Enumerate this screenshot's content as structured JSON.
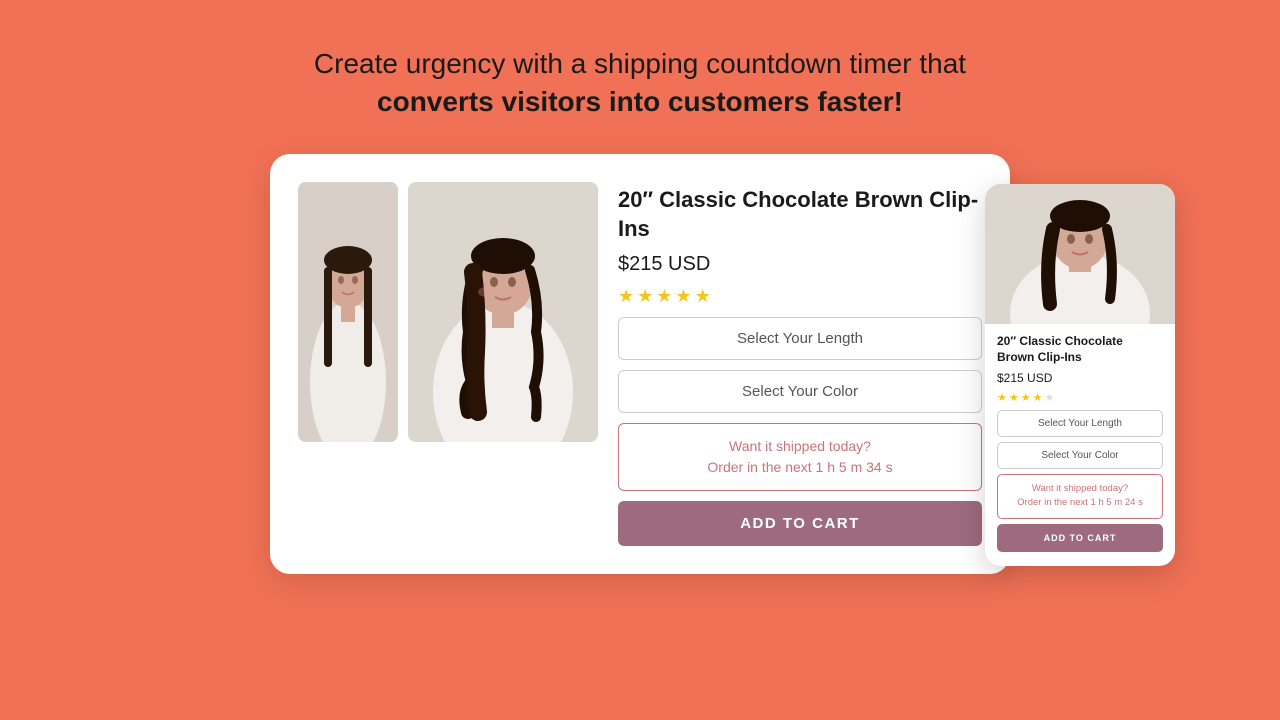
{
  "hero": {
    "line1": "Create urgency with a shipping countdown timer that",
    "line2": "converts visitors into customers faster!"
  },
  "desktop": {
    "product_title": "20″ Classic Chocolate Brown Clip-Ins",
    "price": "$215 USD",
    "stars": [
      "★",
      "★",
      "★",
      "★",
      "★"
    ],
    "select_length_label": "Select Your Length",
    "select_color_label": "Select Your Color",
    "shipping_line1": "Want it shipped today?",
    "shipping_line2": "Order in the next 1 h 5 m 34 s",
    "add_to_cart_label": "ADD TO CART"
  },
  "mobile": {
    "product_title": "20″ Classic Chocolate Brown Clip-Ins",
    "price": "$215 USD",
    "stars": [
      "★",
      "★",
      "★",
      "★",
      "★"
    ],
    "select_length_label": "Select Your Length",
    "select_color_label": "Select Your Color",
    "shipping_line1": "Want it shipped today?",
    "shipping_line2": "Order in the next 1 h 5 m 24 s",
    "add_to_cart_label": "ADD TO CART"
  },
  "colors": {
    "background": "#f07155",
    "cart_btn": "#9d6b7d",
    "shipping_border": "#c9737a",
    "star": "#f5c518"
  }
}
